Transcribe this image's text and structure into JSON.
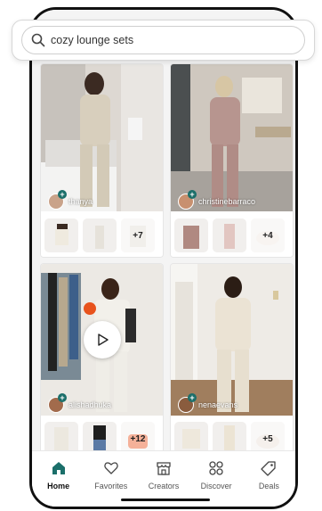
{
  "search": {
    "value": "cozy lounge sets",
    "icon": "search-icon"
  },
  "posts": [
    {
      "creator": "thanya",
      "video": false,
      "more": "+7"
    },
    {
      "creator": "christinebarraco",
      "video": false,
      "more": "+4"
    },
    {
      "creator": "alishadhuka",
      "video": true,
      "more": "+12"
    },
    {
      "creator": "nenaevans",
      "video": false,
      "more": "+5"
    }
  ],
  "nav": [
    {
      "label": "Home",
      "icon": "home-icon",
      "active": true
    },
    {
      "label": "Favorites",
      "icon": "heart-icon"
    },
    {
      "label": "Creators",
      "icon": "storefront-icon"
    },
    {
      "label": "Discover",
      "icon": "grid-circles-icon"
    },
    {
      "label": "Deals",
      "icon": "tag-icon"
    }
  ],
  "colors": {
    "accent": "#1b6f6a",
    "active_nav": "#1b6f6a"
  }
}
